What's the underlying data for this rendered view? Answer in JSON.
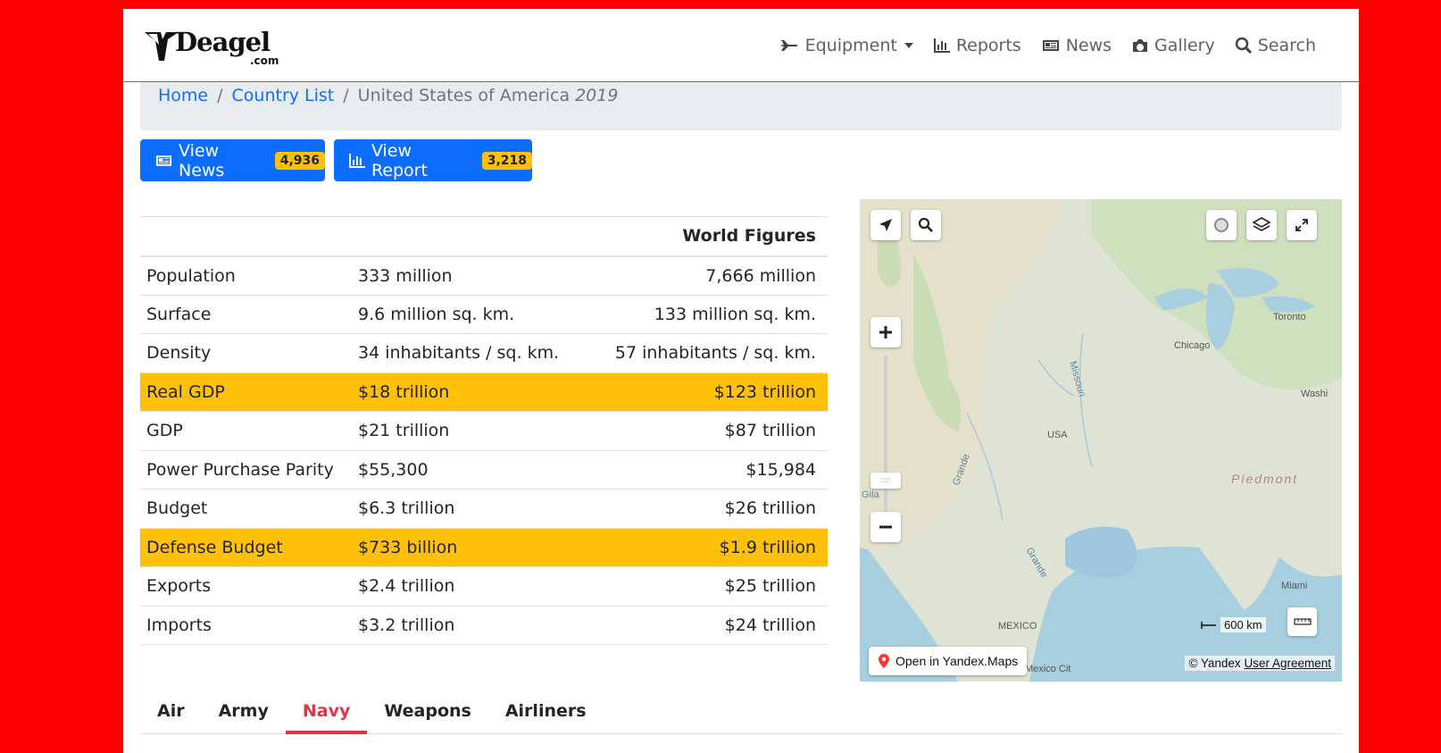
{
  "brand": {
    "name": "Deagel",
    "suffix": ".com"
  },
  "nav": {
    "items": [
      {
        "label": "Equipment",
        "icon": "airplane-icon"
      },
      {
        "label": "Reports",
        "icon": "bar-chart-icon"
      },
      {
        "label": "News",
        "icon": "newspaper-icon"
      },
      {
        "label": "Gallery",
        "icon": "camera-icon"
      },
      {
        "label": "Search",
        "icon": "search-icon"
      }
    ]
  },
  "breadcrumb": {
    "home": "Home",
    "country_list": "Country List",
    "current": "United States of America",
    "year": "2019"
  },
  "buttons": {
    "news": {
      "label": "View News",
      "count": "4,936"
    },
    "report": {
      "label": "View Report",
      "count": "3,218"
    }
  },
  "facts": {
    "header": "World Figures",
    "rows": [
      {
        "label": "Population",
        "country": "333 million",
        "world": "7,666 million",
        "highlight": false
      },
      {
        "label": "Surface",
        "country": "9.6 million sq. km.",
        "world": "133 million sq. km.",
        "highlight": false
      },
      {
        "label": "Density",
        "country": "34 inhabitants / sq. km.",
        "world": "57 inhabitants / sq. km.",
        "highlight": false
      },
      {
        "label": "Real GDP",
        "country": "$18 trillion",
        "world": "$123 trillion",
        "highlight": true
      },
      {
        "label": "GDP",
        "country": "$21 trillion",
        "world": "$87 trillion",
        "highlight": false
      },
      {
        "label": "Power Purchase Parity",
        "country": "$55,300",
        "world": "$15,984",
        "highlight": false
      },
      {
        "label": "Budget",
        "country": "$6.3 trillion",
        "world": "$26 trillion",
        "highlight": false
      },
      {
        "label": "Defense Budget",
        "country": "$733 billion",
        "world": "$1.9 trillion",
        "highlight": true
      },
      {
        "label": "Exports",
        "country": "$2.4 trillion",
        "world": "$25 trillion",
        "highlight": false
      },
      {
        "label": "Imports",
        "country": "$3.2 trillion",
        "world": "$24 trillion",
        "highlight": false
      }
    ]
  },
  "map": {
    "labels": {
      "toronto": "Toronto",
      "chicago": "Chicago",
      "washington": "Washi",
      "usa": "USA",
      "piedmont": "Piedmont",
      "missouri": "Missouri",
      "grande1": "Grande",
      "grande2": "Grande",
      "gila": "Gila",
      "mexico": "MEXICO",
      "miami": "Miami",
      "mexico_city": "Mexico Cit"
    },
    "open_label": "Open in Yandex.Maps",
    "scale": "600 km",
    "copyright": "© Yandex",
    "agreement": "User Agreement"
  },
  "tabs": [
    {
      "label": "Air",
      "active": false
    },
    {
      "label": "Army",
      "active": false
    },
    {
      "label": "Navy",
      "active": true
    },
    {
      "label": "Weapons",
      "active": false
    },
    {
      "label": "Airliners",
      "active": false
    }
  ],
  "colors": {
    "background": "#ff0000",
    "primary": "#0d6efd",
    "highlight": "#ffc107",
    "active_tab": "#dc3545"
  }
}
